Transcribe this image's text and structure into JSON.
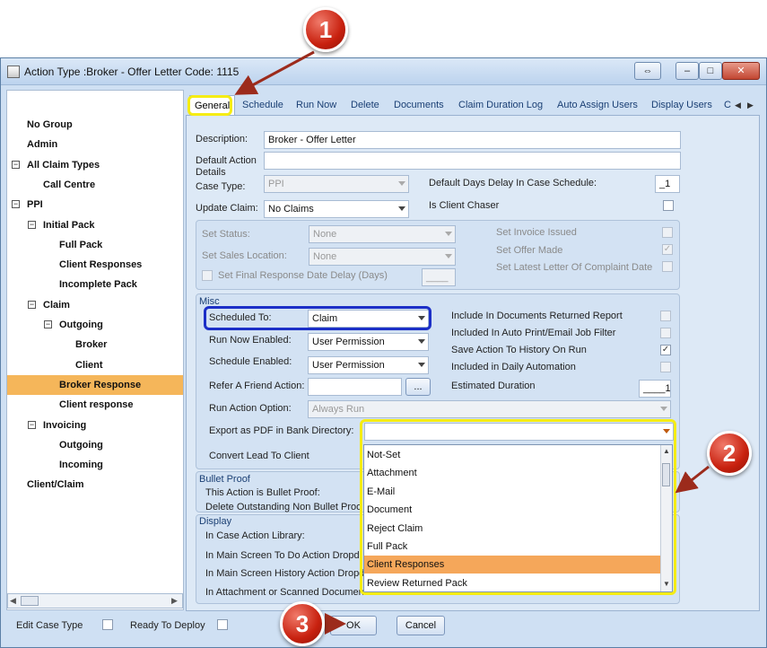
{
  "window": {
    "title": "Action Type :Broker - Offer Letter Code: 1115",
    "buttons": {
      "restore": "⇔",
      "minimize": "–",
      "maximize": "□",
      "close": "✕"
    }
  },
  "tree": [
    {
      "label": "No Group",
      "level": 0,
      "toggle": ""
    },
    {
      "label": "Admin",
      "level": 0,
      "toggle": ""
    },
    {
      "label": "All Claim Types",
      "level": 0,
      "toggle": "−"
    },
    {
      "label": "Call Centre",
      "level": 1,
      "toggle": ""
    },
    {
      "label": "PPI",
      "level": 0,
      "toggle": "−"
    },
    {
      "label": "Initial Pack",
      "level": 1,
      "toggle": "−"
    },
    {
      "label": "Full Pack",
      "level": 2,
      "toggle": ""
    },
    {
      "label": "Client Responses",
      "level": 2,
      "toggle": ""
    },
    {
      "label": "Incomplete Pack",
      "level": 2,
      "toggle": ""
    },
    {
      "label": "Claim",
      "level": 1,
      "toggle": "−"
    },
    {
      "label": "Outgoing",
      "level": 2,
      "toggle": "−"
    },
    {
      "label": "Broker",
      "level": 3,
      "toggle": ""
    },
    {
      "label": "Client",
      "level": 3,
      "toggle": ""
    },
    {
      "label": "Broker Response",
      "level": 2,
      "toggle": "",
      "selected": true
    },
    {
      "label": "Client response",
      "level": 2,
      "toggle": ""
    },
    {
      "label": "Invoicing",
      "level": 1,
      "toggle": "−"
    },
    {
      "label": "Outgoing",
      "level": 2,
      "toggle": ""
    },
    {
      "label": "Incoming",
      "level": 2,
      "toggle": ""
    },
    {
      "label": "Client/Claim",
      "level": 0,
      "toggle": ""
    }
  ],
  "tabs": [
    "General",
    "Schedule",
    "Run Now",
    "Delete",
    "Documents",
    "Claim Duration Log",
    "Auto Assign Users",
    "Display Users",
    "C"
  ],
  "general": {
    "description_label": "Description:",
    "description_value": "Broker - Offer Letter",
    "default_action_details_label": "Default Action Details",
    "case_type_label": "Case Type:",
    "case_type_value": "PPI",
    "default_days_delay_label": "Default Days Delay In Case Schedule:",
    "default_days_delay_value": "_1",
    "update_claim_label": "Update Claim:",
    "update_claim_value": "No Claims",
    "is_client_chaser_label": "Is Client Chaser",
    "set_status_label": "Set Status:",
    "set_status_value": "None",
    "set_sales_location_label": "Set Sales Location:",
    "set_sales_location_value": "None",
    "set_final_response_label": "Set Final Response Date Delay (Days)",
    "set_final_response_value": "____",
    "set_invoice_issued_label": "Set Invoice Issued",
    "set_offer_made_label": "Set Offer Made",
    "set_latest_letter_label": "Set Latest Letter Of Complaint Date"
  },
  "misc": {
    "title": "Misc",
    "scheduled_to_label": "Scheduled To:",
    "scheduled_to_value": "Claim",
    "run_now_enabled_label": "Run Now Enabled:",
    "run_now_enabled_value": "User Permission",
    "schedule_enabled_label": "Schedule Enabled:",
    "schedule_enabled_value": "User Permission",
    "refer_a_friend_label": "Refer A Friend Action:",
    "refer_a_friend_btn": "...",
    "run_action_option_label": "Run Action Option:",
    "run_action_option_value": "Always Run",
    "export_pdf_label": "Export as PDF in Bank Directory:",
    "convert_lead_label": "Convert Lead To Client",
    "include_docs_returned_label": "Include In Documents Returned Report",
    "included_auto_print_label": "Included In Auto Print/Email Job Filter",
    "save_action_history_label": "Save Action To History On Run",
    "included_daily_auto_label": "Included in Daily Automation",
    "estimated_duration_label": "Estimated Duration",
    "estimated_duration_value": "____1"
  },
  "bullet_proof": {
    "title": "Bullet Proof",
    "this_action_label": "This Action is Bullet Proof:",
    "delete_outstanding_label": "Delete Outstanding Non Bullet Proo"
  },
  "display": {
    "title": "Display",
    "in_case_action_library": "In Case Action Library:",
    "in_main_screen_todo": "In Main Screen To Do Action Dropd",
    "in_main_screen_history": "In Main Screen History Action Dropd",
    "in_attachment_scanned": "In Attachment or Scanned Documen"
  },
  "pdf_dropdown_options": [
    "Not-Set",
    "Attachment",
    "E-Mail",
    "Document",
    "Reject Claim",
    "Full Pack",
    "Client Responses",
    "Review Returned Pack"
  ],
  "pdf_dropdown_highlighted": "Client Responses",
  "footer": {
    "edit_case_type_label": "Edit Case Type",
    "ready_to_deploy_label": "Ready To Deploy",
    "ok_label": "OK",
    "cancel_label": "Cancel"
  },
  "callouts": [
    "1",
    "2",
    "3"
  ],
  "colors": {
    "selection": "#f5b65a",
    "dropdown_highlight": "#f5a75a",
    "callout_red": "#c8210f",
    "highlight_yellow": "#f5ec14",
    "highlight_blue": "#1c2fc7"
  }
}
